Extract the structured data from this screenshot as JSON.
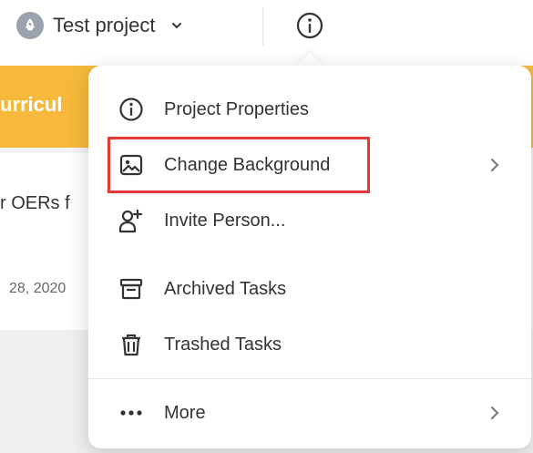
{
  "header": {
    "project_name": "Test project"
  },
  "board": {
    "header_text": "urricul",
    "card_snippet": "r OERs f",
    "card_date": "28, 2020"
  },
  "menu": {
    "items": [
      {
        "label": "Project Properties",
        "icon": "info-circle-icon"
      },
      {
        "label": "Change Background",
        "icon": "image-icon",
        "has_submenu": true,
        "highlighted": true
      },
      {
        "label": "Invite Person...",
        "icon": "add-person-icon"
      },
      {
        "label": "Archived Tasks",
        "icon": "archive-icon"
      },
      {
        "label": "Trashed Tasks",
        "icon": "trash-icon"
      },
      {
        "label": "More",
        "icon": "more-dots-icon",
        "has_submenu": true
      }
    ]
  },
  "colors": {
    "accent_yellow": "#f6b93b",
    "highlight_red": "#e53935"
  }
}
